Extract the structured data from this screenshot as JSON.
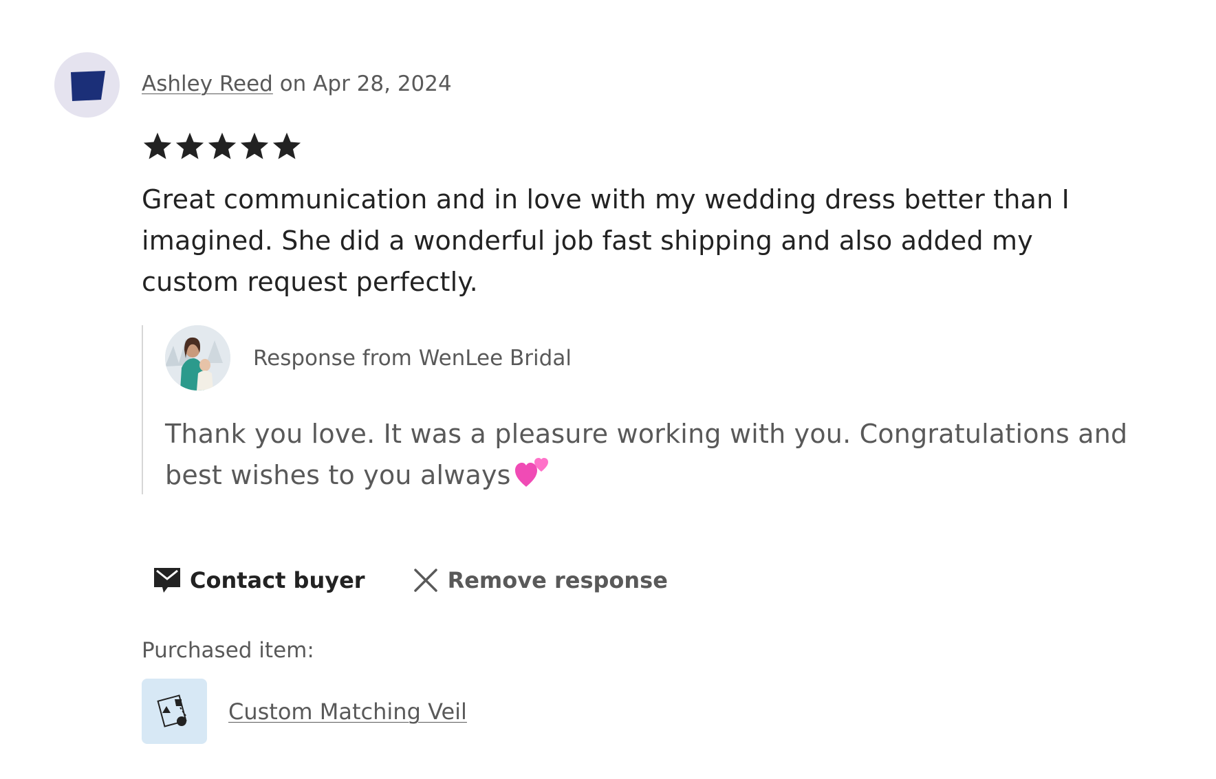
{
  "review": {
    "reviewer_name": "Ashley Reed",
    "date_text": " on Apr 28, 2024",
    "rating": 5,
    "rating_max": 5,
    "text": "Great communication and in love with my wedding dress better than I imagined. She did a wonderful job fast shipping and also added my custom request perfectly."
  },
  "response": {
    "title": "Response from WenLee Bridal",
    "text": "Thank you love. It was a pleasure working with you. Congratulations and best wishes to you always",
    "emoji_icon": "two-hearts-icon"
  },
  "actions": {
    "contact_label": "Contact buyer",
    "contact_icon": "mail-icon",
    "remove_label": "Remove response",
    "remove_icon": "close-icon"
  },
  "purchase": {
    "label": "Purchased item:",
    "item_name": "Custom Matching Veil"
  },
  "colors": {
    "star": "#222222",
    "avatar_bg": "#e5e3ef",
    "avatar_shape": "#1b2f78",
    "thumb_bg": "#d7e8f5",
    "heart": "#f04bb5"
  }
}
